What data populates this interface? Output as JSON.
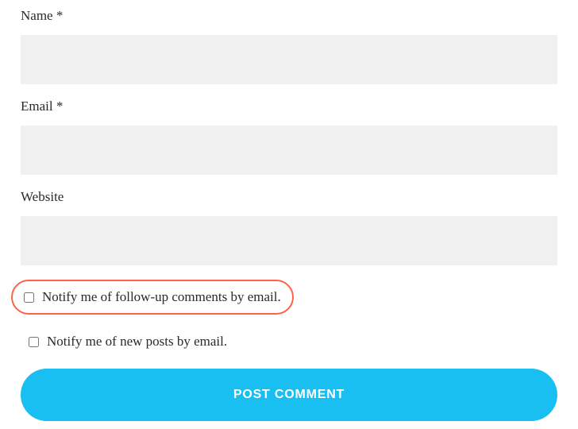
{
  "form": {
    "name": {
      "label": "Name ",
      "required_marker": "*"
    },
    "email": {
      "label": "Email ",
      "required_marker": "*"
    },
    "website": {
      "label": "Website"
    },
    "notify_comments": {
      "label": "Notify me of follow-up comments by email."
    },
    "notify_posts": {
      "label": "Notify me of new posts by email."
    },
    "submit": {
      "label": "POST COMMENT"
    }
  }
}
